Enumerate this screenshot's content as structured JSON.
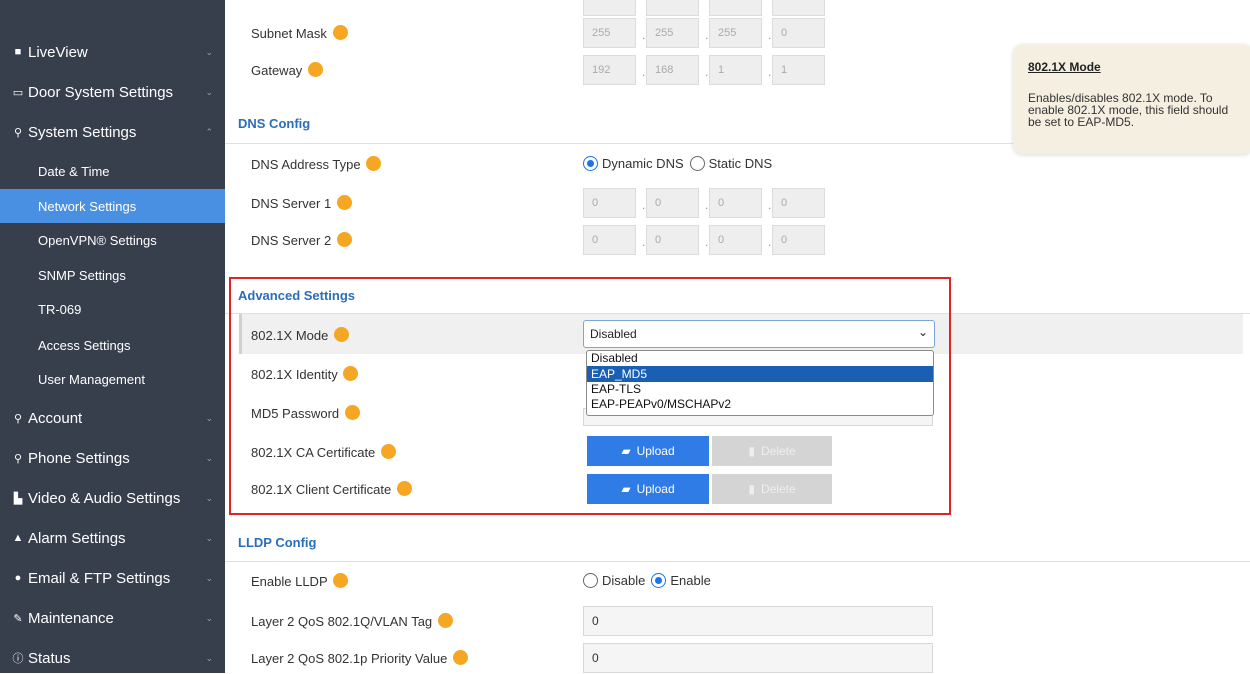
{
  "sidebar": {
    "items": [
      {
        "label": "LiveView",
        "icon": "liveview-icon"
      },
      {
        "label": "Door System Settings",
        "icon": "door-icon"
      },
      {
        "label": "System Settings",
        "icon": "system-settings-icon"
      },
      {
        "label": "Account",
        "icon": "account-icon"
      },
      {
        "label": "Phone Settings",
        "icon": "phone-icon"
      },
      {
        "label": "Video & Audio Settings",
        "icon": "video-audio-icon"
      },
      {
        "label": "Alarm Settings",
        "icon": "alarm-icon"
      },
      {
        "label": "Email & FTP Settings",
        "icon": "email-ftp-icon"
      },
      {
        "label": "Maintenance",
        "icon": "wrench-icon"
      },
      {
        "label": "Status",
        "icon": "info-icon"
      }
    ],
    "subitems": [
      "Date & Time",
      "Network Settings",
      "OpenVPN® Settings",
      "SNMP Settings",
      "TR-069",
      "Access Settings",
      "User Management"
    ],
    "active_subitem": "Network Settings"
  },
  "network": {
    "subnet_label": "Subnet Mask",
    "subnet": [
      "255",
      "255",
      "255",
      "0"
    ],
    "gateway_label": "Gateway",
    "gateway": [
      "192",
      "168",
      "1",
      "1"
    ]
  },
  "dns": {
    "title": "DNS Config",
    "type_label": "DNS Address Type",
    "type_options": [
      "Dynamic DNS",
      "Static DNS"
    ],
    "type_selected": "Dynamic DNS",
    "server1_label": "DNS Server 1",
    "server1": [
      "0",
      "0",
      "0",
      "0"
    ],
    "server2_label": "DNS Server 2",
    "server2": [
      "0",
      "0",
      "0",
      "0"
    ]
  },
  "advanced": {
    "title": "Advanced Settings",
    "mode_label": "802.1X Mode",
    "mode_value": "Disabled",
    "mode_options": [
      "Disabled",
      "EAP_MD5",
      "EAP-TLS",
      "EAP-PEAPv0/MSCHAPv2"
    ],
    "mode_highlighted": "EAP_MD5",
    "identity_label": "802.1X Identity",
    "md5_label": "MD5 Password",
    "ca_label": "802.1X CA Certificate",
    "client_label": "802.1X Client Certificate",
    "upload_label": "Upload",
    "delete_label": "Delete"
  },
  "lldp": {
    "title": "LLDP Config",
    "enable_label": "Enable LLDP",
    "enable_options": [
      "Disable",
      "Enable"
    ],
    "enable_selected": "Enable",
    "vlan_label": "Layer 2 QoS 802.1Q/VLAN Tag",
    "vlan_value": "0",
    "priority_label": "Layer 2 QoS 802.1p Priority Value",
    "priority_value": "0"
  },
  "tooltip": {
    "title": "802.1X Mode",
    "body": "Enables/disables 802.1X mode. To enable 802.1X mode, this field should be set to EAP-MD5."
  },
  "colors": {
    "sidebar_bg": "#373f4d",
    "active_item": "#4a90e2",
    "section_title": "#2a6ebb",
    "highlight_box": "#e02424",
    "dropdown_highlight": "#1a5fb4"
  }
}
